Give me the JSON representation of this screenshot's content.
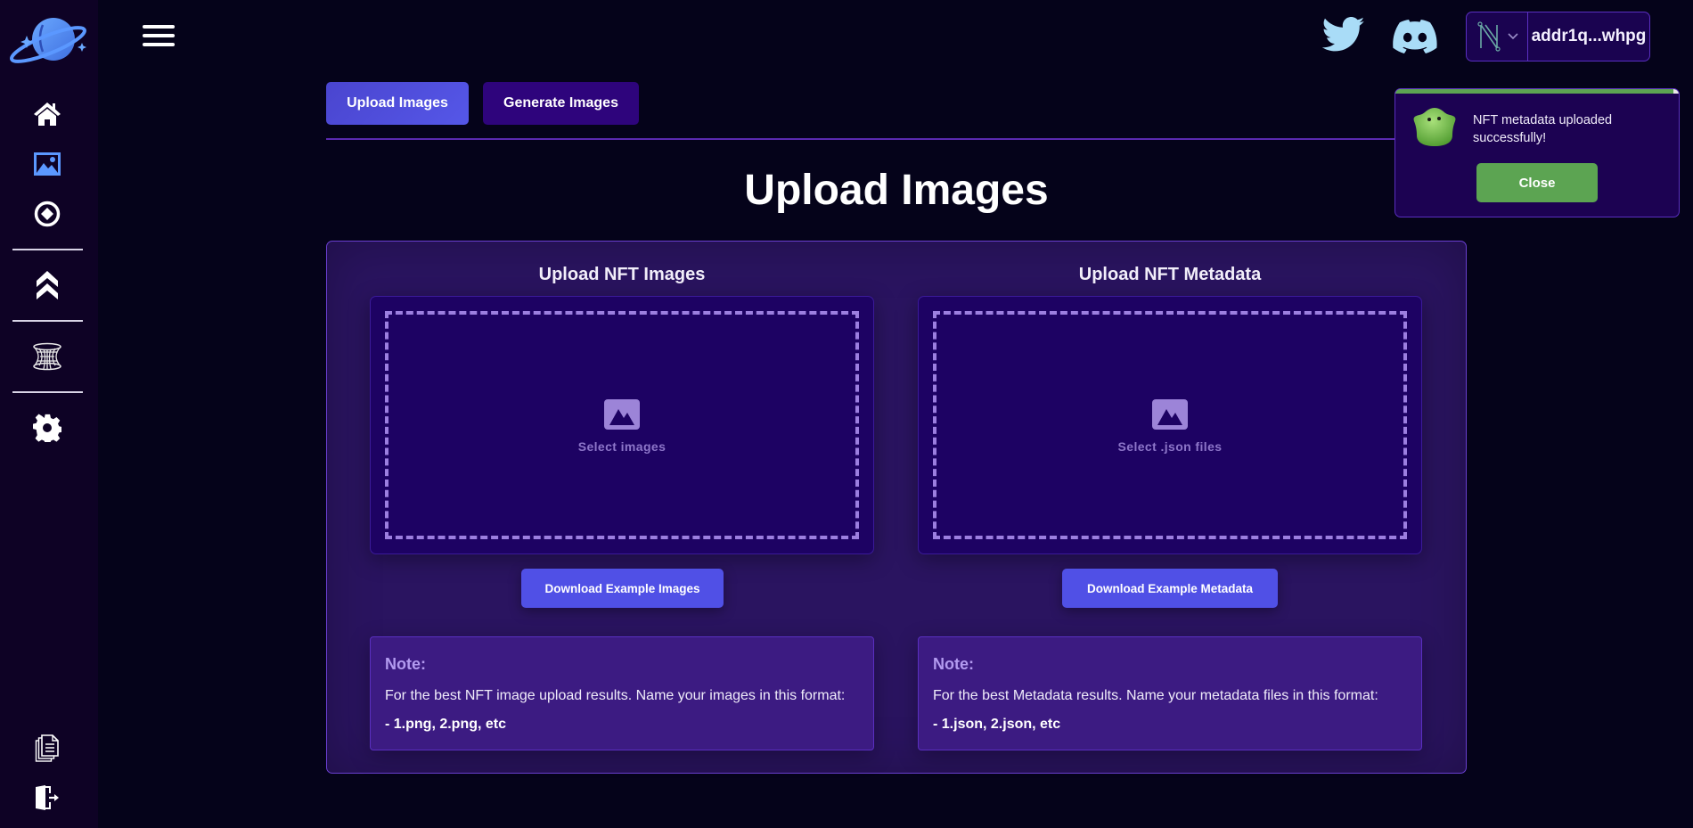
{
  "header": {
    "menu_icon": "hamburger-icon",
    "social": [
      {
        "name": "twitter",
        "icon": "twitter-icon",
        "color": "#a9dcf7"
      },
      {
        "name": "discord",
        "icon": "discord-icon",
        "color": "#a9dcf7"
      }
    ],
    "wallet": {
      "provider_icon": "nami-wallet-icon",
      "address": "addr1q...whpg"
    }
  },
  "sidebar": {
    "logo_icon": "planet-logo-icon",
    "items": [
      {
        "name": "home",
        "icon": "home-icon",
        "active": false
      },
      {
        "name": "images",
        "icon": "image-icon",
        "active": true
      },
      {
        "name": "mint",
        "icon": "target-icon",
        "active": false
      },
      {
        "name": "upgrade",
        "icon": "chevrons-up-icon",
        "active": false
      },
      {
        "name": "wormhole",
        "icon": "wormhole-icon",
        "active": false
      },
      {
        "name": "settings",
        "icon": "gear-icon",
        "active": false
      }
    ],
    "bottom_items": [
      {
        "name": "docs",
        "icon": "documents-icon"
      },
      {
        "name": "logout",
        "icon": "logout-icon"
      }
    ]
  },
  "tabs": [
    {
      "label": "Upload Images",
      "active": true
    },
    {
      "label": "Generate Images",
      "active": false
    }
  ],
  "page_title": "Upload Images",
  "sections": {
    "images": {
      "title": "Upload NFT Images",
      "drop_label": "Select images",
      "download_label": "Download Example Images",
      "note_title": "Note:",
      "note_body": "For the best NFT image upload results. Name your images in this format:",
      "note_format": "- 1.png, 2.png, etc"
    },
    "metadata": {
      "title": "Upload NFT Metadata",
      "drop_label": "Select .json files",
      "download_label": "Download Example Metadata",
      "note_title": "Note:",
      "note_body": "For the best Metadata results. Name your metadata files in this format:",
      "note_format": "- 1.json, 2.json, etc"
    }
  },
  "toast": {
    "message": "NFT metadata uploaded successfully!",
    "close_label": "Close",
    "progress": 0.98,
    "icon": "slime-mascot-icon",
    "color": "#5ca452"
  },
  "colors": {
    "accent": "#5050e6",
    "tab_inactive": "#2e047c",
    "panel": "#2a1460",
    "dropzone": "#1d0263",
    "success": "#5ca452"
  }
}
